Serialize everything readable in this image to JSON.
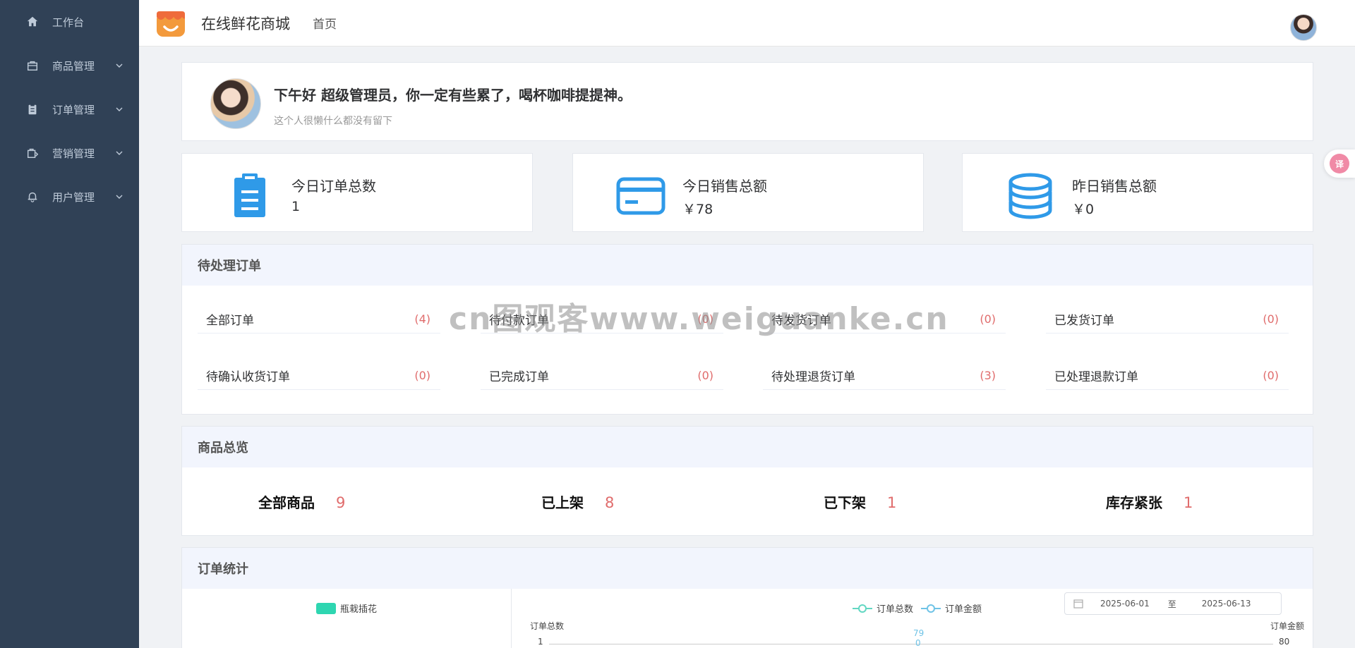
{
  "sidebar": {
    "items": [
      {
        "label": "工作台",
        "icon": "home-icon",
        "expandable": false
      },
      {
        "label": "商品管理",
        "icon": "bag-icon",
        "expandable": true
      },
      {
        "label": "订单管理",
        "icon": "clipboard-icon",
        "expandable": true
      },
      {
        "label": "营销管理",
        "icon": "marketing-icon",
        "expandable": true
      },
      {
        "label": "用户管理",
        "icon": "bell-icon",
        "expandable": true
      }
    ]
  },
  "header": {
    "title": "在线鲜花商城",
    "breadcrumb": "首页"
  },
  "welcome": {
    "greeting": "下午好 超级管理员，你一定有些累了，喝杯咖啡提提神。",
    "bio": "这个人很懒什么都没有留下"
  },
  "stats": [
    {
      "label": "今日订单总数",
      "value": "1",
      "icon": "clipboard-icon"
    },
    {
      "label": "今日销售总额",
      "value": "￥78",
      "icon": "card-icon"
    },
    {
      "label": "昨日销售总额",
      "value": "￥0",
      "icon": "coins-icon"
    }
  ],
  "pending": {
    "title": "待处理订单",
    "rows": [
      [
        {
          "label": "全部订单",
          "count": "(4)"
        },
        {
          "label": "待付款订单",
          "count": "(0)"
        },
        {
          "label": "待发货订单",
          "count": "(0)"
        },
        {
          "label": "已发货订单",
          "count": "(0)"
        }
      ],
      [
        {
          "label": "待确认收货订单",
          "count": "(0)"
        },
        {
          "label": "已完成订单",
          "count": "(0)"
        },
        {
          "label": "待处理退货订单",
          "count": "(3)"
        },
        {
          "label": "已处理退款订单",
          "count": "(0)"
        }
      ]
    ]
  },
  "goods": {
    "title": "商品总览",
    "items": [
      {
        "label": "全部商品",
        "value": "9"
      },
      {
        "label": "已上架",
        "value": "8"
      },
      {
        "label": "已下架",
        "value": "1"
      },
      {
        "label": "库存紧张",
        "value": "1"
      }
    ]
  },
  "order_stats": {
    "title": "订单统计",
    "pie_legend": "瓶栽插花",
    "line_legend": [
      "订单总数",
      "订单金额"
    ],
    "date_from": "2025-06-01",
    "date_sep": "至",
    "date_to": "2025-06-13",
    "axis_left_label": "订单总数",
    "axis_right_label": "订单金额",
    "axis_left_max": "1",
    "axis_right_max": "80",
    "mark_label_1": "79",
    "mark_label_2": "0"
  },
  "watermark": "cn图观客www.weiguanke.cn",
  "colors": {
    "sidebar_bg": "#304156",
    "accent_blue": "#2f9ae8",
    "count_red": "#e06c6c",
    "pie_green": "#2ed6b1"
  }
}
